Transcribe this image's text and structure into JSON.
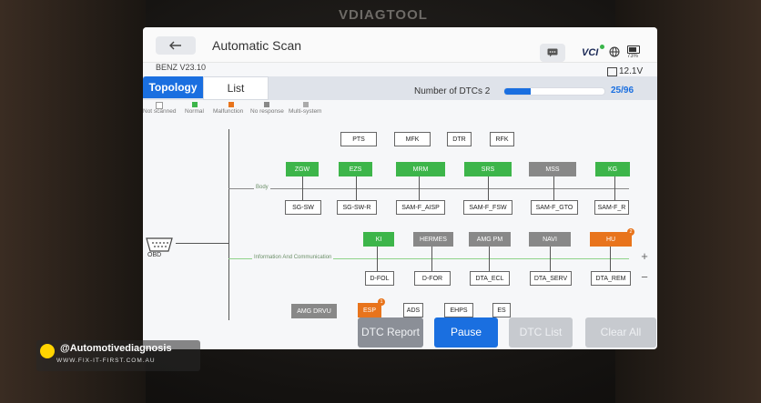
{
  "device": {
    "brand": "VDIAGTOOL"
  },
  "header": {
    "title": "Automatic Scan",
    "vci_label": "VCI",
    "battery_percent": "73%"
  },
  "vehicle": {
    "model": "BENZ V23.10",
    "voltage": "12.1V"
  },
  "tabs": [
    {
      "label": "Topology"
    },
    {
      "label": "List"
    }
  ],
  "dtc": {
    "label": "Number of DTCs 2",
    "progress_text": "25/96",
    "progress_fraction": 0.26
  },
  "legend": [
    {
      "label": "Not scanned",
      "color": "#ffffff"
    },
    {
      "label": "Normal",
      "color": "#3db54a"
    },
    {
      "label": "Malfunction",
      "color": "#e8741c"
    },
    {
      "label": "No response",
      "color": "#888888"
    },
    {
      "label": "Multi-system",
      "color": "#aaaaaa"
    }
  ],
  "topology": {
    "obd_label": "OBD",
    "bus_body": "Body",
    "bus_info": "Information And Communication",
    "row1": [
      "PTS",
      "MFK",
      "DTR",
      "RFK"
    ],
    "row2": [
      "ZGW",
      "EZS",
      "MRM",
      "SRS",
      "MSS",
      "KG"
    ],
    "row3": [
      "SG-SW",
      "SG-SW-R",
      "SAM-F_AISP",
      "SAM-F_FSW",
      "SAM-F_GTO",
      "SAM-F_R"
    ],
    "row4": [
      "KI",
      "HERMES",
      "AMG PM",
      "NAVI",
      "HU"
    ],
    "row5": [
      "D-FOL",
      "D-FOR",
      "DTA_ECL",
      "DTA_SERV",
      "DTA_REM"
    ],
    "row6": [
      "AMG DRVU",
      "ESP",
      "ADS",
      "EHPS",
      "ES"
    ],
    "badges": {
      "hu": "2",
      "esp": "1"
    }
  },
  "zoom": {
    "in": "+",
    "out": "−"
  },
  "buttons": {
    "dtc_report": "DTC Report",
    "pause": "Pause",
    "dtc_list": "DTC List",
    "clear_all": "Clear All DTCs"
  },
  "watermark": {
    "handle": "@Automotivediagnosis",
    "site": "WWW.FIX-IT-FIRST.COM.AU"
  }
}
